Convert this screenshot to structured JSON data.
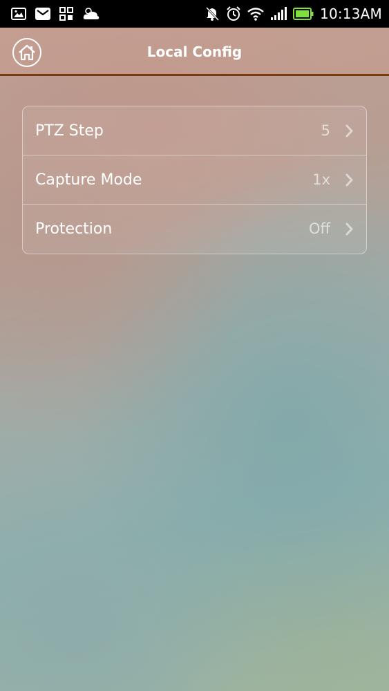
{
  "status_bar": {
    "time": "10:13AM",
    "left_icons": [
      "gallery-icon",
      "mail-icon",
      "apps-grid-icon",
      "weather-cloud-icon"
    ],
    "right_icons": [
      "notifications-muted-icon",
      "alarm-icon",
      "wifi-icon",
      "signal-icon",
      "battery-icon"
    ],
    "battery_color": "#7ee03a"
  },
  "app_bar": {
    "title": "Local Config",
    "home_icon": "home-icon",
    "divider_color": "#7a3a12"
  },
  "settings": {
    "items": [
      {
        "label": "PTZ Step",
        "value": "5"
      },
      {
        "label": "Capture Mode",
        "value": "1x"
      },
      {
        "label": "Protection",
        "value": "Off"
      }
    ]
  }
}
